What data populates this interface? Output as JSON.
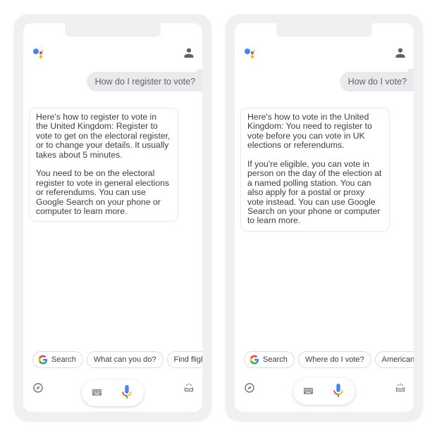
{
  "phones": [
    {
      "user_query": "How do I register to vote?",
      "reply_paragraphs": [
        "Here's how to register to vote in the United Kingdom: Register to vote to get on the electoral register, or to change your details. It usually takes about 5 minutes.",
        "You need to be on the electoral register to vote in general elections or referendums. You can use Google Search on your phone or computer to learn more."
      ],
      "chips": [
        "Search",
        "What can you do?",
        "Find flights"
      ]
    },
    {
      "user_query": "How do I vote?",
      "reply_paragraphs": [
        "Here's how to vote in the United Kingdom: You need to register to vote before you can vote in UK elections or referendums.",
        "If you're eligible, you can vote in person on the day of the election at a named polling station. You can also apply for a postal or proxy vote instead. You can use Google Search on your phone or computer to learn more."
      ],
      "chips": [
        "Search",
        "Where do I vote?",
        "American idol vote"
      ]
    }
  ],
  "icons": {
    "logo": "google-assistant-logo",
    "account": "account-icon",
    "search_chip": "google-g-icon",
    "explore": "compass-icon",
    "keyboard": "keyboard-icon",
    "mic": "microphone-icon",
    "updates": "snapshot-tray-icon"
  },
  "colors": {
    "google_blue": "#4285f4",
    "google_red": "#ea4335",
    "google_yellow": "#fbbc05",
    "google_green": "#34a853",
    "user_bubble": "#e9eaed",
    "frame": "#f1f0ef"
  }
}
